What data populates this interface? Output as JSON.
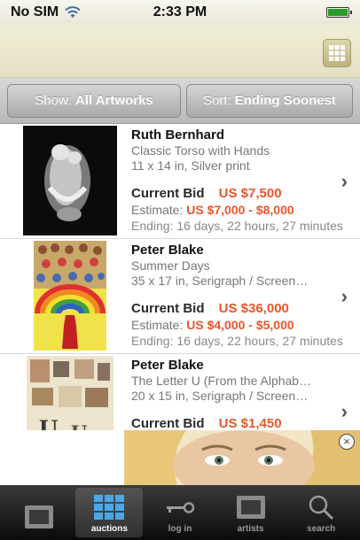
{
  "status_bar": {
    "carrier": "No SIM",
    "time": "2:33 PM"
  },
  "filters": {
    "show_label": "Show:",
    "show_value": "All Artworks",
    "sort_label": "Sort:",
    "sort_value": "Ending Soonest"
  },
  "listings": [
    {
      "artist": "Ruth Bernhard",
      "title": "Classic Torso with Hands",
      "details": "11 x 14 in, Silver print",
      "bid_label": "Current Bid",
      "bid_value": "US $7,500",
      "estimate_label": "Estimate:",
      "estimate_value": "US $7,000 - $8,000",
      "ending": "Ending: 16 days, 22 hours, 27 minutes"
    },
    {
      "artist": "Peter Blake",
      "title": "Summer Days",
      "details": "35 x 17 in, Serigraph / Screen…",
      "bid_label": "Current Bid",
      "bid_value": "US $36,000",
      "estimate_label": "Estimate:",
      "estimate_value": "US $4,000 - $5,000",
      "ending": "Ending: 16 days, 22 hours, 27 minutes"
    },
    {
      "artist": "Peter Blake",
      "title": "The Letter U (From the Alphab…",
      "details": "20 x 15 in, Serigraph / Screen…",
      "bid_label": "Current Bid",
      "bid_value": "US $1,450"
    }
  ],
  "tabs": [
    {
      "label": "",
      "icon": "frame-icon"
    },
    {
      "label": "auctions",
      "icon": "grid-icon",
      "active": true
    },
    {
      "label": "log in",
      "icon": "key-icon"
    },
    {
      "label": "artists",
      "icon": "frame-icon"
    },
    {
      "label": "search",
      "icon": "search-icon"
    }
  ],
  "colors": {
    "accent": "#e8562a",
    "nav_bar": "#ece8cf",
    "tab_bar": "#1a1a1a"
  }
}
